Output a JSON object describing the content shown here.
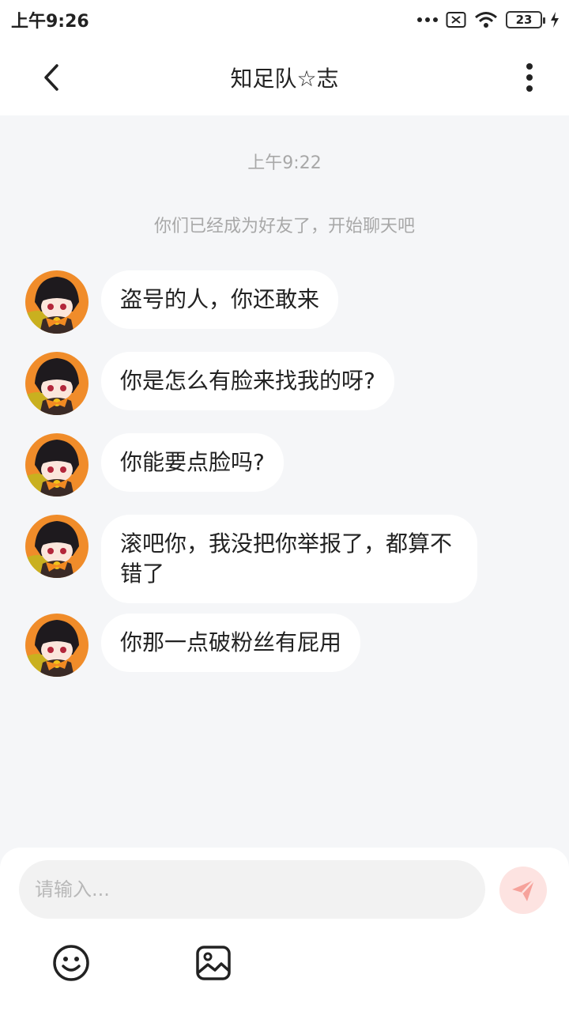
{
  "status_bar": {
    "time": "上午9:26",
    "battery": "23"
  },
  "header": {
    "title": "知足队☆志"
  },
  "chat": {
    "timestamp": "上午9:22",
    "system_notice": "你们已经成为好友了，开始聊天吧",
    "messages": [
      {
        "text": "盗号的人，你还敢来"
      },
      {
        "text": "你是怎么有脸来找我的呀?"
      },
      {
        "text": "你能要点脸吗?"
      },
      {
        "text": "滚吧你，我没把你举报了，都算不错了"
      },
      {
        "text": "你那一点破粉丝有屁用"
      }
    ]
  },
  "input": {
    "placeholder": "请输入..."
  },
  "colors": {
    "background": "#f5f6f8",
    "bubble": "#ffffff",
    "send_button": "#fde3e1",
    "send_icon": "#f6a29b"
  },
  "icons": {
    "back": "chevron-left-icon",
    "more": "more-vertical-icon",
    "send": "paper-plane-icon",
    "emoji": "smiley-icon",
    "image": "image-icon"
  }
}
